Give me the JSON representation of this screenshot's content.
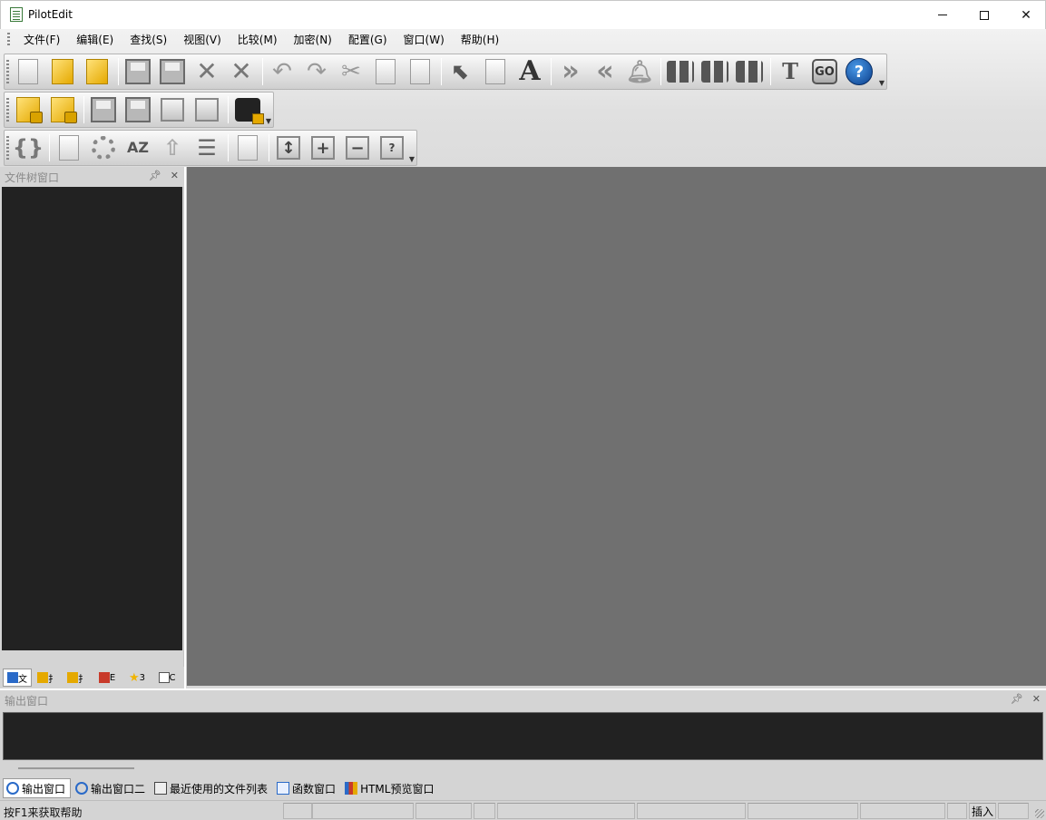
{
  "window": {
    "title": "PilotEdit"
  },
  "menu": [
    "文件(F)",
    "编辑(E)",
    "查找(S)",
    "视图(V)",
    "比较(M)",
    "加密(N)",
    "配置(G)",
    "窗口(W)",
    "帮助(H)"
  ],
  "toolbar1": [
    {
      "icon": "new-file-icon"
    },
    {
      "icon": "open-folder-icon"
    },
    {
      "icon": "open-remote-icon"
    },
    {
      "icon": "save-icon"
    },
    {
      "icon": "save-all-icon"
    },
    {
      "icon": "close-icon"
    },
    {
      "icon": "close-all-icon"
    },
    {
      "icon": "undo-icon"
    },
    {
      "icon": "redo-icon"
    },
    {
      "icon": "cut-icon"
    },
    {
      "icon": "copy-icon"
    },
    {
      "icon": "paste-icon"
    },
    {
      "icon": "select-icon"
    },
    {
      "icon": "column-icon"
    },
    {
      "icon": "font-icon",
      "glyph": "A"
    },
    {
      "icon": "indent-icon",
      "glyph": "»"
    },
    {
      "icon": "outdent-icon",
      "glyph": "«"
    },
    {
      "icon": "bell-icon"
    },
    {
      "icon": "find-icon"
    },
    {
      "icon": "find-next-icon"
    },
    {
      "icon": "find-prev-icon"
    },
    {
      "icon": "text-replace-icon"
    },
    {
      "icon": "go-icon",
      "glyph": "GO"
    },
    {
      "icon": "help-icon",
      "glyph": "?"
    }
  ],
  "toolbar2": [
    {
      "icon": "encrypt-file-icon"
    },
    {
      "icon": "decrypt-file-icon"
    },
    {
      "icon": "encrypt-save-icon"
    },
    {
      "icon": "decrypt-save-icon"
    },
    {
      "icon": "encrypt-remote-icon"
    },
    {
      "icon": "decrypt-remote-icon"
    },
    {
      "icon": "camera-lock-icon"
    }
  ],
  "toolbar3": [
    {
      "icon": "brace-icon",
      "glyph": "{}"
    },
    {
      "icon": "file-settings-icon"
    },
    {
      "icon": "gear-icon"
    },
    {
      "icon": "sort-az-icon",
      "glyph": "AZ"
    },
    {
      "icon": "move-up-icon",
      "glyph": "⇧"
    },
    {
      "icon": "format-icon",
      "glyph": "☰"
    },
    {
      "icon": "zoom-icon"
    },
    {
      "icon": "expand-icon",
      "glyph": "↕"
    },
    {
      "icon": "plus-icon",
      "glyph": "+"
    },
    {
      "icon": "minus-icon",
      "glyph": "−"
    },
    {
      "icon": "query-icon",
      "glyph": "?"
    }
  ],
  "left_panel": {
    "title": "文件树窗口",
    "tabs": [
      {
        "label": "文",
        "icon": "tree-icon",
        "color": "#2a6ac8"
      },
      {
        "label": "扌",
        "icon": "folder-icon",
        "color": "#e5a900"
      },
      {
        "label": "扌",
        "icon": "folder-remote-icon",
        "color": "#e5a900"
      },
      {
        "label": "E",
        "icon": "chart-icon",
        "color": "#c83a2a"
      },
      {
        "label": "3",
        "icon": "star-icon",
        "color": "#f0b400"
      },
      {
        "label": "C",
        "icon": "windows-icon",
        "color": "#555555"
      }
    ]
  },
  "output_panel": {
    "title": "输出窗口"
  },
  "bottom_tabs": [
    {
      "label": "输出窗口",
      "icon": "output-icon"
    },
    {
      "label": "输出窗口二",
      "icon": "output2-icon"
    },
    {
      "label": "最近使用的文件列表",
      "icon": "recent-files-icon"
    },
    {
      "label": "函数窗口",
      "icon": "function-icon"
    },
    {
      "label": "HTML预览窗口",
      "icon": "html-preview-icon"
    }
  ],
  "status": {
    "help_text": "按F1来获取帮助",
    "mode": "插入"
  },
  "colors": {
    "editor_bg": "#707070",
    "panel_dark": "#222222",
    "chrome": "#d4d4d4"
  }
}
